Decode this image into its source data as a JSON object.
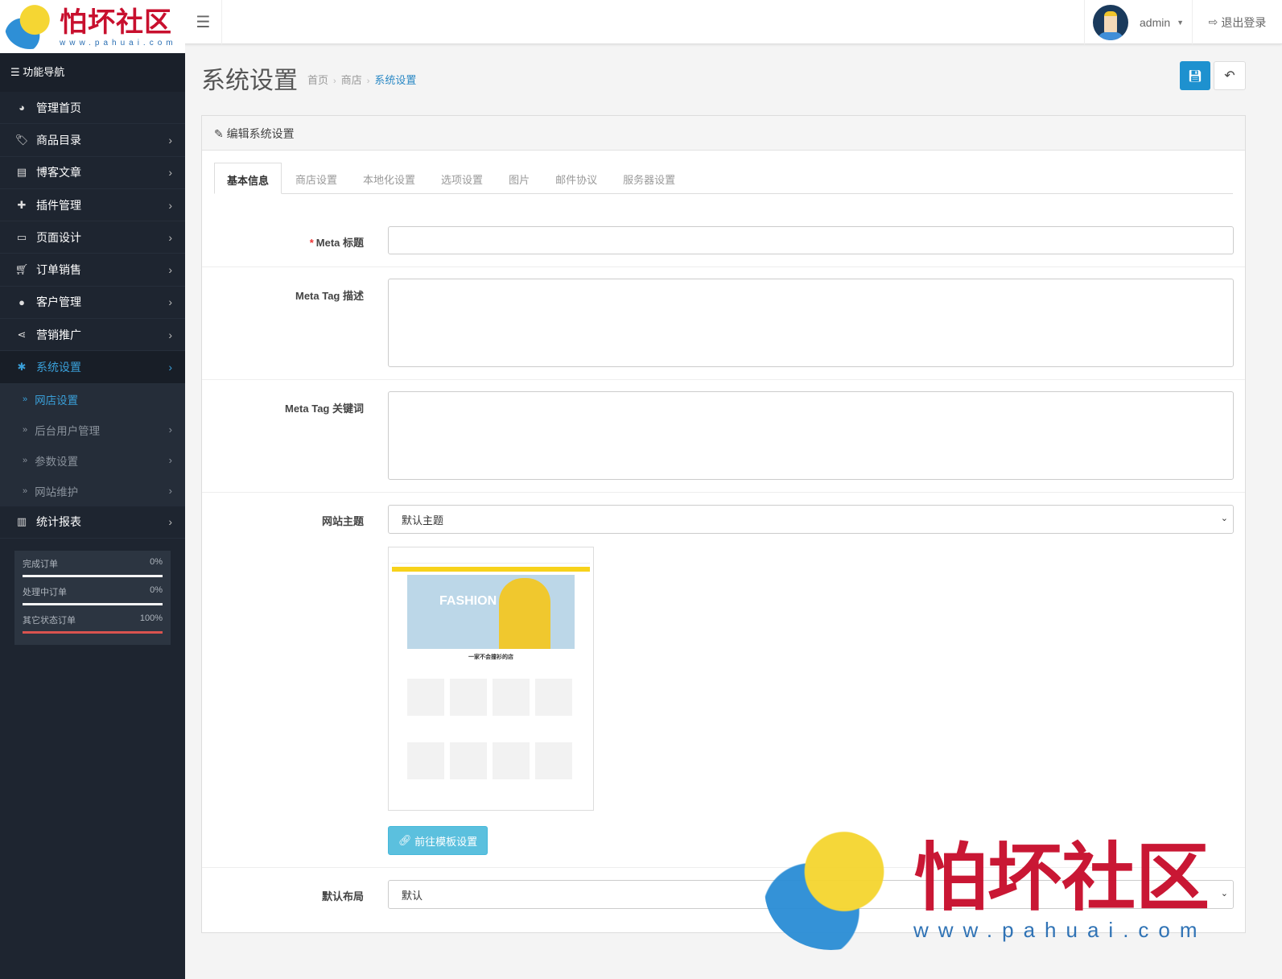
{
  "logo": {
    "text": "怕坏社区",
    "url": "www.pahuai.com"
  },
  "header": {
    "menu_icon": "bars-icon",
    "user": "admin",
    "logout": "退出登录"
  },
  "sidebar": {
    "title": "功能导航",
    "items": [
      {
        "label": "管理首页",
        "icon": "dashboard-icon"
      },
      {
        "label": "商品目录",
        "icon": "tags-icon"
      },
      {
        "label": "博客文章",
        "icon": "newspaper-icon"
      },
      {
        "label": "插件管理",
        "icon": "puzzle-icon"
      },
      {
        "label": "页面设计",
        "icon": "desktop-icon"
      },
      {
        "label": "订单销售",
        "icon": "cart-icon"
      },
      {
        "label": "客户管理",
        "icon": "user-icon"
      },
      {
        "label": "营销推广",
        "icon": "share-icon"
      },
      {
        "label": "系统设置",
        "icon": "cog-icon"
      }
    ],
    "subitems": [
      {
        "label": "网店设置"
      },
      {
        "label": "后台用户管理"
      },
      {
        "label": "参数设置"
      },
      {
        "label": "网站维护"
      }
    ],
    "reports": {
      "label": "统计报表",
      "icon": "bar-chart-icon"
    },
    "stats": [
      {
        "label": "完成订单",
        "value": "0%",
        "pct": 0
      },
      {
        "label": "处理中订单",
        "value": "0%",
        "pct": 0
      },
      {
        "label": "其它状态订单",
        "value": "100%",
        "pct": 100
      }
    ]
  },
  "page": {
    "title": "系统设置",
    "breadcrumb": [
      "首页",
      "商店",
      "系统设置"
    ]
  },
  "panel": {
    "title": "编辑系统设置",
    "tabs": [
      "基本信息",
      "商店设置",
      "本地化设置",
      "选项设置",
      "图片",
      "邮件协议",
      "服务器设置"
    ],
    "fields": {
      "meta_title": {
        "label": "Meta 标题",
        "value": ""
      },
      "meta_desc": {
        "label": "Meta Tag 描述",
        "value": ""
      },
      "meta_keywords": {
        "label": "Meta Tag 关键词",
        "value": ""
      },
      "theme": {
        "label": "网站主题",
        "value": "默认主题"
      },
      "layout": {
        "label": "默认布局",
        "value": "默认"
      }
    },
    "preview": {
      "banner": "FASHION",
      "shop_title": "一家不会撞衫的店"
    },
    "template_button": "前往模板设置"
  }
}
